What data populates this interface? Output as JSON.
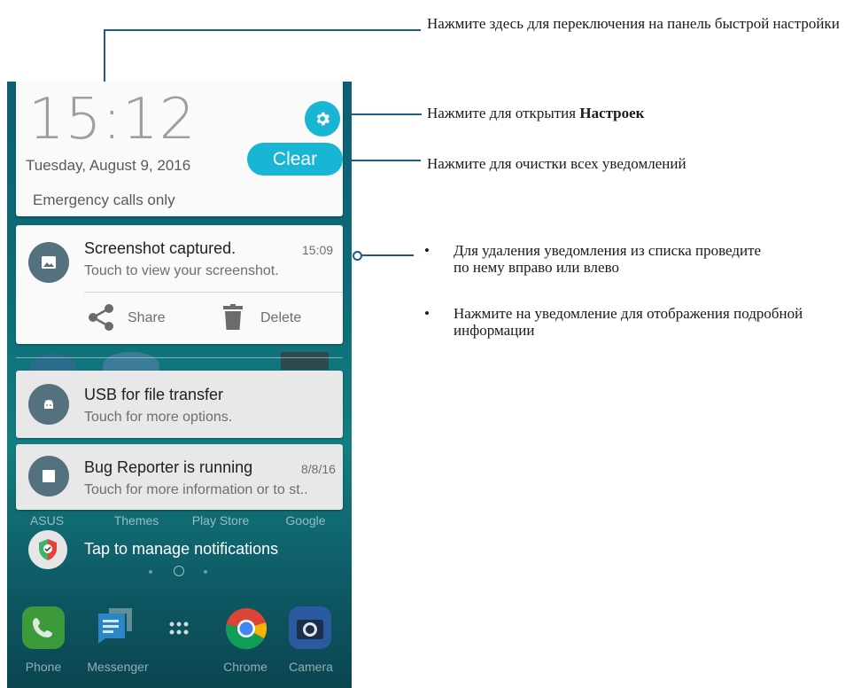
{
  "callouts": {
    "quick_settings": "Нажмите здесь для переключения на панель быстрой настройки",
    "settings_prefix": "Нажмите для открытия ",
    "settings_bold": "Настроек",
    "clear": "Нажмите для очистки всех уведомлений",
    "bullets": [
      "Для удаления уведомления из списка проведите по нему вправо или влево",
      "Нажмите на уведомление для отображения подробной информации"
    ],
    "bullet_char": "•"
  },
  "header": {
    "time": "15:12",
    "date": "Tuesday, August 9, 2016",
    "emergency": "Emergency calls only",
    "clear_label": "Clear"
  },
  "notifications": [
    {
      "title": "Screenshot captured.",
      "subtitle": "Touch to view your screenshot.",
      "time": "15:09",
      "icon": "image-icon",
      "actions": [
        {
          "label": "Share",
          "icon": "share-icon"
        },
        {
          "label": "Delete",
          "icon": "trash-icon"
        }
      ]
    },
    {
      "title": "USB for file transfer",
      "subtitle": "Touch for more options.",
      "time": "",
      "icon": "android-icon"
    },
    {
      "title": "Bug Reporter is running",
      "subtitle": "Touch for more information or to st..",
      "time": "8/8/16",
      "icon": "stop-icon"
    }
  ],
  "manage": "Tap to manage notifications",
  "home_labels": [
    "ASUS",
    "Themes",
    "Play Store",
    "Google"
  ],
  "dock": [
    {
      "label": "Phone",
      "icon": "phone-icon"
    },
    {
      "label": "Messenger",
      "icon": "messenger-icon"
    },
    {
      "label": "",
      "icon": "app-drawer-icon"
    },
    {
      "label": "Chrome",
      "icon": "chrome-icon"
    },
    {
      "label": "Camera",
      "icon": "camera-icon"
    }
  ],
  "colors": {
    "accent": "#19b5d5",
    "callout_line": "#1f5a8a",
    "notif_icon": "#55707e"
  }
}
